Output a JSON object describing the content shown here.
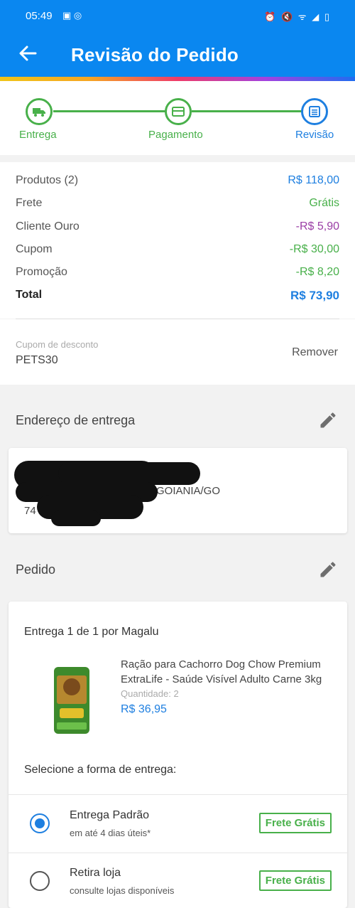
{
  "status_bar": {
    "time": "05:49",
    "left_icons": "▣ ◎",
    "right_icons": "⏰ 🔇 ᯤ ◢ ▯"
  },
  "header": {
    "title": "Revisão do Pedido"
  },
  "steps": [
    {
      "label": "Entrega",
      "state": "done",
      "icon": "truck-icon"
    },
    {
      "label": "Pagamento",
      "state": "done",
      "icon": "card-icon"
    },
    {
      "label": "Revisão",
      "state": "current",
      "icon": "list-icon"
    }
  ],
  "summary": {
    "rows": [
      {
        "label": "Produtos (2)",
        "value": "R$ 118,00",
        "color": "#1e7fe0"
      },
      {
        "label": "Frete",
        "value": "Grátis",
        "color": "#48b04a"
      },
      {
        "label": "Cliente Ouro",
        "value": "-R$ 5,90",
        "color": "#9b3fa6"
      },
      {
        "label": "Cupom",
        "value": "-R$ 30,00",
        "color": "#48b04a"
      },
      {
        "label": "Promoção",
        "value": "-R$ 8,20",
        "color": "#48b04a"
      }
    ],
    "total": {
      "label": "Total",
      "value": "R$ 73,90",
      "color": "#1e7fe0"
    }
  },
  "coupon": {
    "label": "Cupom de desconto",
    "code": "PETS30",
    "remove_label": "Remover"
  },
  "address": {
    "heading": "Endereço de entrega",
    "city_line": "GOIANIA/GO",
    "zip_partial": "74"
  },
  "order": {
    "heading": "Pedido",
    "delivery_title": "Entrega 1 de 1 por Magalu",
    "product": {
      "name": "Ração para Cachorro Dog Chow Premium ExtraLife - Saúde Visível Adulto Carne 3kg",
      "quantity": "Quantidade: 2",
      "price": "R$ 36,95"
    },
    "select_label": "Selecione a forma de entrega:",
    "options": [
      {
        "name": "Entrega Padrão",
        "sub": "em até 4 dias úteis*",
        "badge": "Frete Grátis",
        "selected": true
      },
      {
        "name": "Retira loja",
        "sub": "consulte lojas disponíveis",
        "badge": "Frete Grátis",
        "selected": false
      }
    ]
  }
}
